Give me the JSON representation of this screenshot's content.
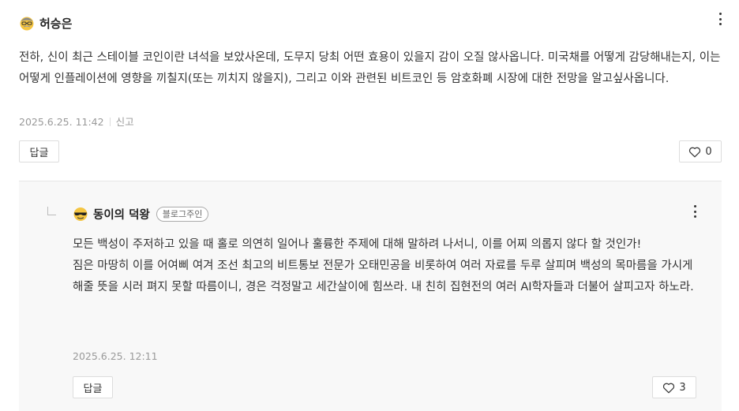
{
  "comment": {
    "author": "허승은",
    "text": "전하, 신이 최근 스테이블 코인이란 녀석을 보았사온데, 도무지 당최 어떤 효용이 있을지 감이 오질 않사옵니다. 미국채를 어떻게 감당해내는지, 이는 어떻게 인플레이션에 영향을 끼칠지(또는 끼치지 않을지), 그리고 이와 관련된 비트코인 등 암호화폐 시장에 대한 전망을 알고싶사옵니다.",
    "date": "2025.6.25. 11:42",
    "report_label": "신고",
    "reply_button": "답글",
    "likes": "0"
  },
  "reply": {
    "author": "동이의 덕왕",
    "badge": "블로그주인",
    "text_1": "모든 백성이 주저하고 있을 때 홀로 의연히 일어나 훌륭한 주제에 대해 말하려 나서니, 이를 어찌 의롭지 않다 할 것인가!",
    "text_2": "짐은 마땅히 이를 어여삐 여겨 조선 최고의 비트통보 전문가 오태민공을 비롯하여 여러 자료를 두루 살피며 백성의 목마름을 가시게 해줄 뜻을 시러 펴지 못할 따름이니, 경은 걱정말고 세간살이에 힘쓰라. 내 친히 집현전의 여러 AI학자들과 더불어 살피고자 하노라.",
    "date": "2025.6.25. 12:11",
    "reply_button": "답글",
    "likes": "3"
  },
  "icons": {
    "more": "more-vertical-icon",
    "heart": "heart-outline-icon",
    "avatar1": "old-man-emoji-avatar",
    "avatar2": "sunglasses-emoji-avatar"
  }
}
